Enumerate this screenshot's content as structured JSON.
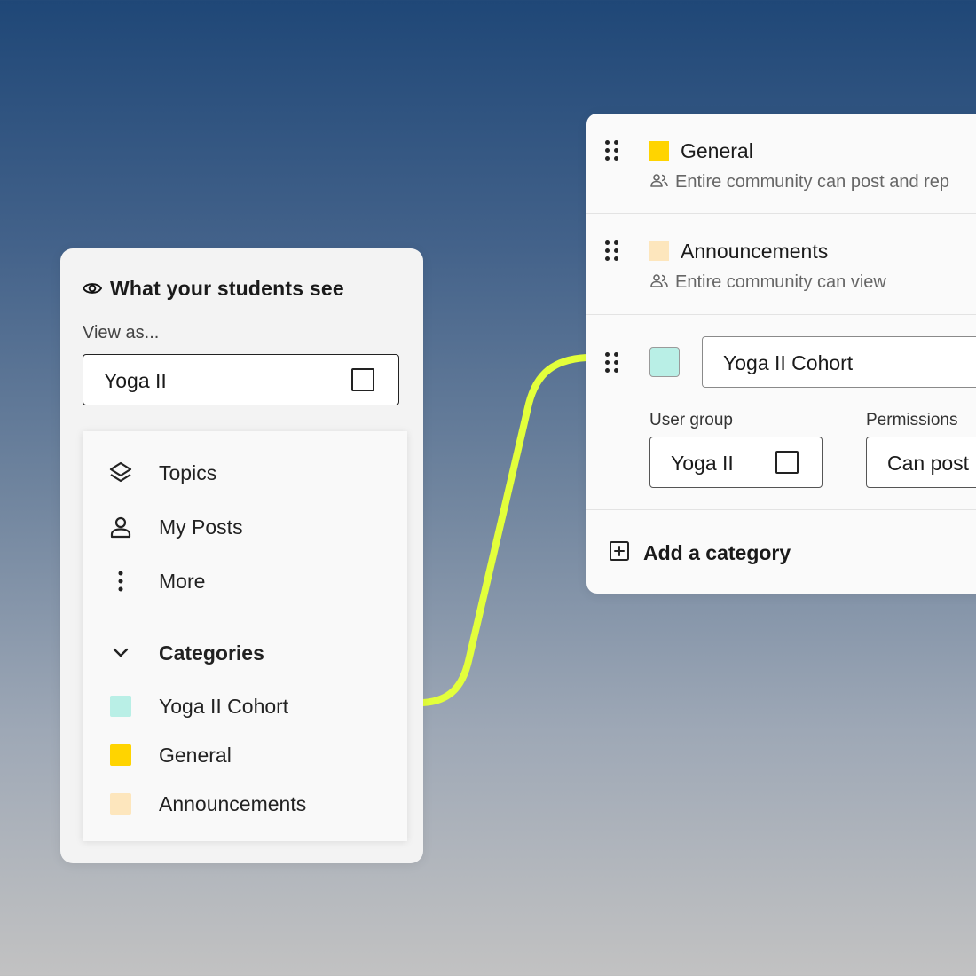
{
  "colors": {
    "connector": "#e3ff3b",
    "cohort": "#b9efe6",
    "general": "#ffd400",
    "announcements": "#fde6bd"
  },
  "student_view": {
    "title": "What your students see",
    "title_icon": "eye-icon",
    "view_as_label": "View as...",
    "view_as_value": "Yoga II",
    "menu": [
      {
        "label": "Topics",
        "icon": "layers-icon"
      },
      {
        "label": "My Posts",
        "icon": "user-icon"
      },
      {
        "label": "More",
        "icon": "more-vertical-icon"
      }
    ],
    "categories_heading": "Categories",
    "categories": [
      {
        "label": "Yoga II Cohort",
        "color": "#b9efe6"
      },
      {
        "label": "General",
        "color": "#ffd400"
      },
      {
        "label": "Announcements",
        "color": "#fde6bd"
      }
    ]
  },
  "category_editor": {
    "rows": [
      {
        "name": "General",
        "permission": "Entire community can post and rep",
        "color": "#ffd400"
      },
      {
        "name": "Announcements",
        "permission": "Entire community can view",
        "color": "#fde6bd"
      }
    ],
    "edit_row": {
      "name_value": "Yoga II Cohort",
      "color": "#b9efe6",
      "user_group_label": "User group",
      "user_group_value": "Yoga II",
      "permissions_label": "Permissions",
      "permissions_value": "Can post"
    },
    "add_label": "Add a category"
  }
}
